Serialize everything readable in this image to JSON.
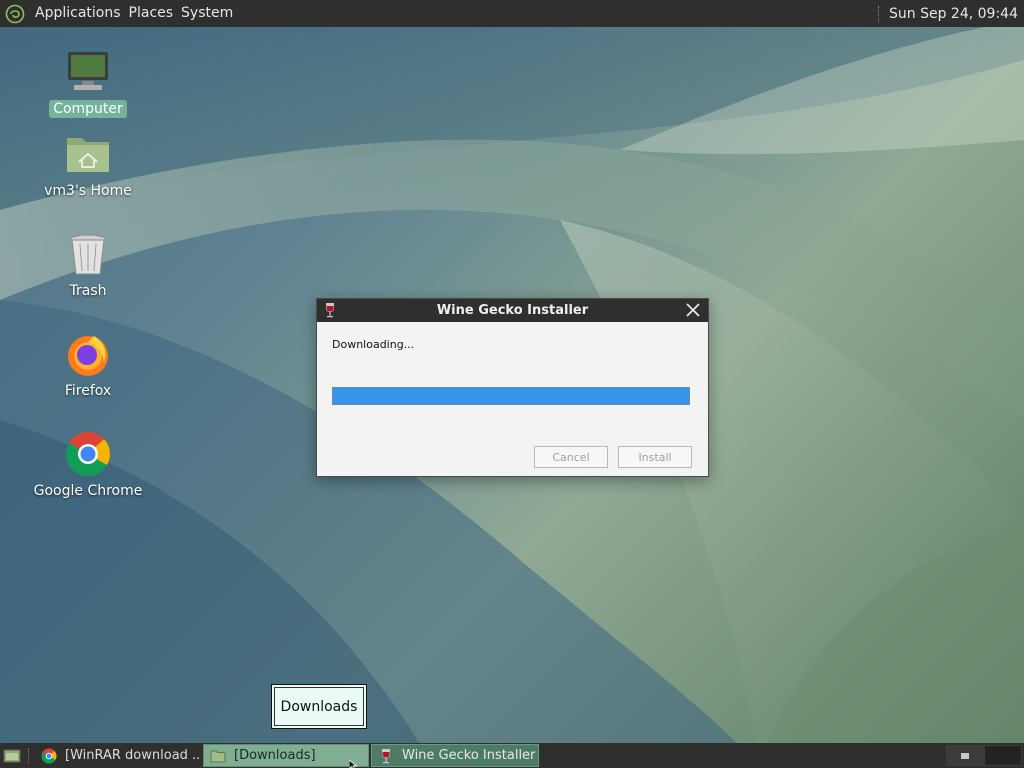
{
  "top_panel": {
    "menus": [
      "Applications",
      "Places",
      "System"
    ],
    "clock": "Sun Sep 24, 09:44"
  },
  "desktop_icons": [
    {
      "label": "Computer",
      "icon": "computer-icon",
      "selected": true
    },
    {
      "label": "vm3's Home",
      "icon": "home-folder-icon",
      "selected": false
    },
    {
      "label": "Trash",
      "icon": "trash-icon",
      "selected": false
    },
    {
      "label": "Firefox",
      "icon": "firefox-icon",
      "selected": false
    },
    {
      "label": "Google Chrome",
      "icon": "chrome-icon",
      "selected": false
    }
  ],
  "dialog": {
    "title": "Wine Gecko Installer",
    "status": "Downloading...",
    "progress": 1.0,
    "cancel_label": "Cancel",
    "install_label": "Install",
    "buttons_enabled": false
  },
  "tooltip": {
    "text": "Downloads"
  },
  "taskbar": {
    "tasks": [
      {
        "label": "[WinRAR download ...",
        "icon": "chrome-icon",
        "state": "normal"
      },
      {
        "label": "[Downloads]",
        "icon": "folder-icon",
        "state": "minimized-hover"
      },
      {
        "label": "Wine Gecko Installer",
        "icon": "wine-icon",
        "state": "active"
      }
    ],
    "workspaces": 2
  },
  "colors": {
    "panel": "#2f302e",
    "selection": "#74b39a",
    "progress": "#3595ea",
    "tooltip_bg": "#e9fbf3"
  }
}
